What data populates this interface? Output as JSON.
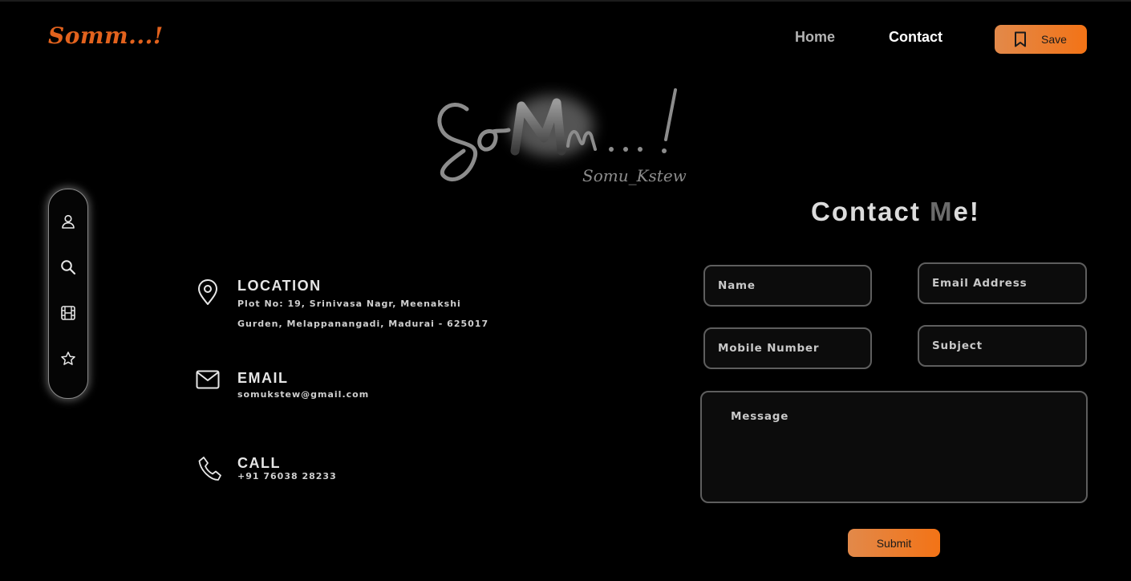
{
  "header": {
    "brand": "Somm...!",
    "nav": {
      "home": "Home",
      "contact": "Contact"
    },
    "save_label": "Save"
  },
  "hero": {
    "signature": "SoMm...!",
    "sub_signature": "Somu_Kstew"
  },
  "sidebar": {
    "items": [
      "user-icon",
      "search-icon",
      "film-icon",
      "star-icon"
    ]
  },
  "contact": {
    "title_main": "Contact ",
    "title_m": "M",
    "title_end": "e!",
    "location": {
      "heading": "LOCATION",
      "line1": "Plot No: 19, Srinivasa Nagr, Meenakshi",
      "line2": "Gurden, Melappanangadi, Madurai - 625017"
    },
    "email": {
      "heading": "EMAIL",
      "value": "somukstew@gmail.com"
    },
    "call": {
      "heading": "CALL",
      "value": "+91 76038 28233"
    }
  },
  "form": {
    "name_placeholder": "Name",
    "email_placeholder": "Email Address",
    "mobile_placeholder": "Mobile Number",
    "subject_placeholder": "Subject",
    "message_placeholder": "Message",
    "submit_label": "Submit"
  },
  "colors": {
    "accent": "#f37316",
    "brand": "#e2621d",
    "background": "#000000"
  }
}
